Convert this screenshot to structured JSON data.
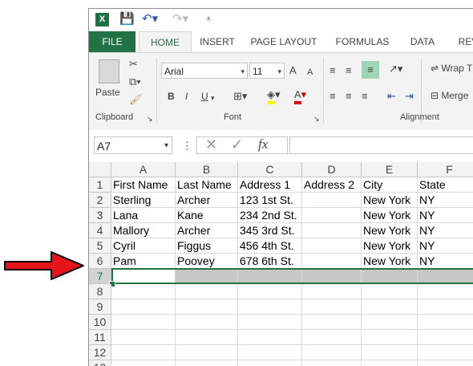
{
  "app": {
    "logo": "X"
  },
  "qat": {
    "save_icon": "save-icon",
    "undo_icon": "undo-icon",
    "redo_icon": "redo-icon"
  },
  "tabs": [
    {
      "label": "FILE"
    },
    {
      "label": "HOME"
    },
    {
      "label": "INSERT"
    },
    {
      "label": "PAGE LAYOUT"
    },
    {
      "label": "FORMULAS"
    },
    {
      "label": "DATA"
    },
    {
      "label": "REV"
    }
  ],
  "ribbon": {
    "clipboard": {
      "paste_label": "Paste",
      "group_label": "Clipboard"
    },
    "font": {
      "name": "Arial",
      "size": "11",
      "grow": "A",
      "shrink": "A",
      "bold": "B",
      "italic": "I",
      "underline": "U",
      "font_color": "A",
      "group_label": "Font"
    },
    "alignment": {
      "wrap_label": "Wrap T",
      "merge_label": "Merge",
      "group_label": "Alignment"
    }
  },
  "formula_bar": {
    "name_box": "A7",
    "fx": "fx",
    "content": ""
  },
  "columns": [
    "A",
    "B",
    "C",
    "D",
    "E",
    "F"
  ],
  "rows": [
    {
      "num": "1",
      "cells": [
        "First Name",
        "Last Name",
        "Address 1",
        "Address 2",
        "City",
        "State"
      ]
    },
    {
      "num": "2",
      "cells": [
        "Sterling",
        "Archer",
        "123 1st St.",
        "",
        "New York",
        "NY"
      ]
    },
    {
      "num": "3",
      "cells": [
        "Lana",
        "Kane",
        "234 2nd St.",
        "",
        "New York",
        "NY"
      ]
    },
    {
      "num": "4",
      "cells": [
        "Mallory",
        "Archer",
        "345 3rd St.",
        "",
        "New York",
        "NY"
      ]
    },
    {
      "num": "5",
      "cells": [
        "Cyril",
        "Figgus",
        "456 4th St.",
        "",
        "New York",
        "NY"
      ]
    },
    {
      "num": "6",
      "cells": [
        "Pam",
        "Poovey",
        "678 6th St.",
        "",
        "New York",
        "NY"
      ]
    },
    {
      "num": "7",
      "cells": [
        "",
        "",
        "",
        "",
        "",
        ""
      ]
    },
    {
      "num": "8",
      "cells": [
        "",
        "",
        "",
        "",
        "",
        ""
      ]
    },
    {
      "num": "9",
      "cells": [
        "",
        "",
        "",
        "",
        "",
        ""
      ]
    },
    {
      "num": "10",
      "cells": [
        "",
        "",
        "",
        "",
        "",
        ""
      ]
    },
    {
      "num": "11",
      "cells": [
        "",
        "",
        "",
        "",
        "",
        ""
      ]
    },
    {
      "num": "12",
      "cells": [
        "",
        "",
        "",
        "",
        "",
        ""
      ]
    },
    {
      "num": "13",
      "cells": [
        "",
        "",
        "",
        "",
        "",
        ""
      ]
    }
  ],
  "selected_row": "7",
  "colors": {
    "accent": "#217346",
    "arrow": "#e3151a",
    "selection": "#c6c6c6"
  }
}
